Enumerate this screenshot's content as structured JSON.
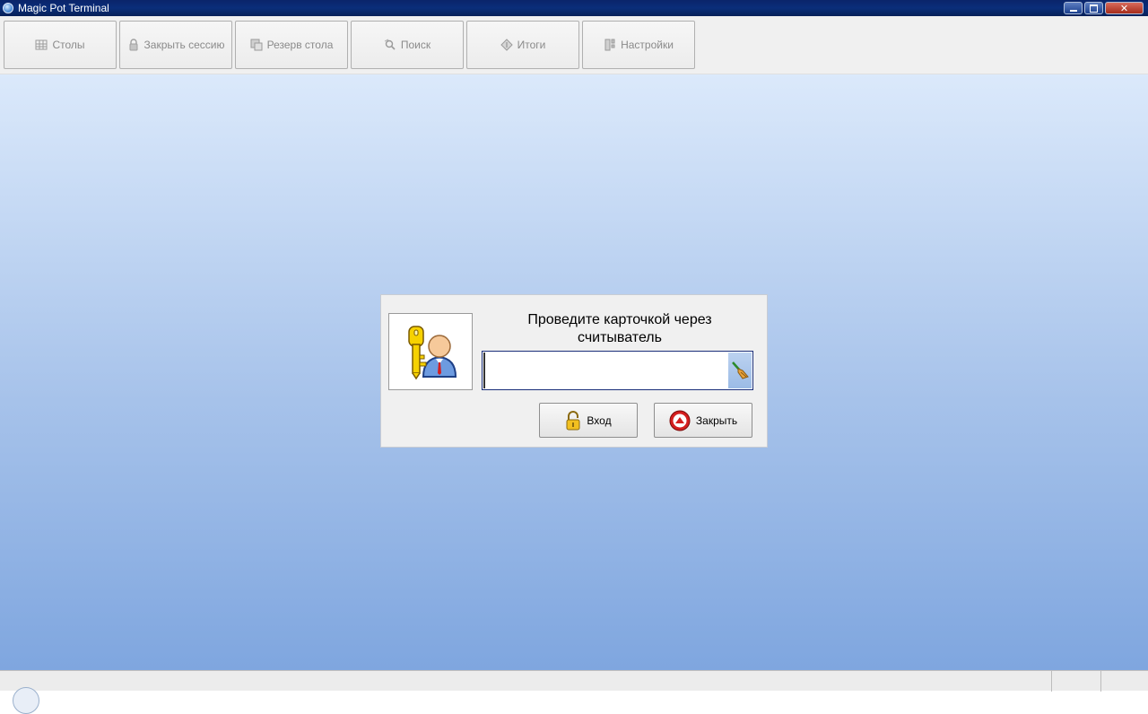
{
  "window": {
    "title": "Magic Pot Terminal",
    "controls": [
      "minimize-icon",
      "maximize-icon",
      "close-icon"
    ]
  },
  "toolbar": {
    "items": [
      {
        "label": "Столы",
        "icon": "tables-icon"
      },
      {
        "label": "Закрыть сессию",
        "icon": "lock-icon"
      },
      {
        "label": "Резерв стола",
        "icon": "reserve-icon"
      },
      {
        "label": "Поиск",
        "icon": "search-icon"
      },
      {
        "label": "Итоги",
        "icon": "totals-icon"
      },
      {
        "label": "Настройки",
        "icon": "settings-icon"
      }
    ]
  },
  "login": {
    "prompt_line1": "Проведите карточкой через",
    "prompt_line2": "считыватель",
    "card_value": "",
    "login_label": "Вход",
    "close_label": "Закрыть",
    "avatar_icon": "user-key-icon",
    "clear_icon": "broom-icon"
  },
  "colors": {
    "titlebar": "#0a246a",
    "workspace_top": "#dbe9fb",
    "workspace_bottom": "#7fa6df",
    "toolbar_text": "#8a8a8a"
  }
}
